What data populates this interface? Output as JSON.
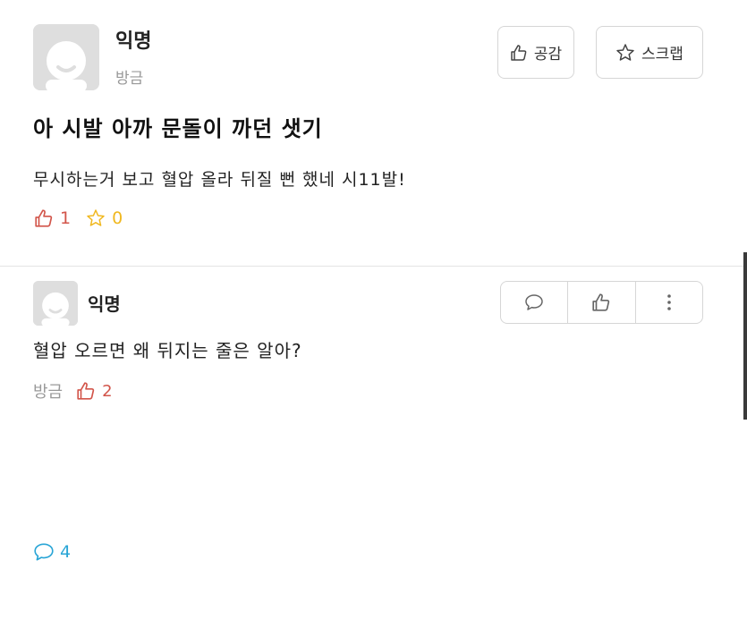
{
  "post": {
    "author": "익명",
    "time": "방금",
    "like_button_label": "공감",
    "scrap_button_label": "스크랩",
    "title": "아 시발 아까 문돌이 까던 샛기",
    "body": "무시하는거 보고 혈압 올라 뒤질 뻔 했네 시11발!",
    "stats": {
      "likes": "1",
      "comments": "4",
      "scraps": "0"
    }
  },
  "comment": {
    "author": "익명",
    "text": "혈압 오르면 왜 뒤지는 줄은 알아?",
    "time": "방금",
    "likes": "2"
  },
  "colors": {
    "like": "#d2554a",
    "comment": "#29a5d6",
    "scrap": "#f0b820",
    "muted": "#999999",
    "border": "#d6d6d6"
  },
  "icons": {
    "avatar": "avatar-default-icon",
    "like": "thumbs-up-icon",
    "scrap": "star-icon",
    "comment": "speech-bubble-icon",
    "more": "more-vertical-icon"
  }
}
